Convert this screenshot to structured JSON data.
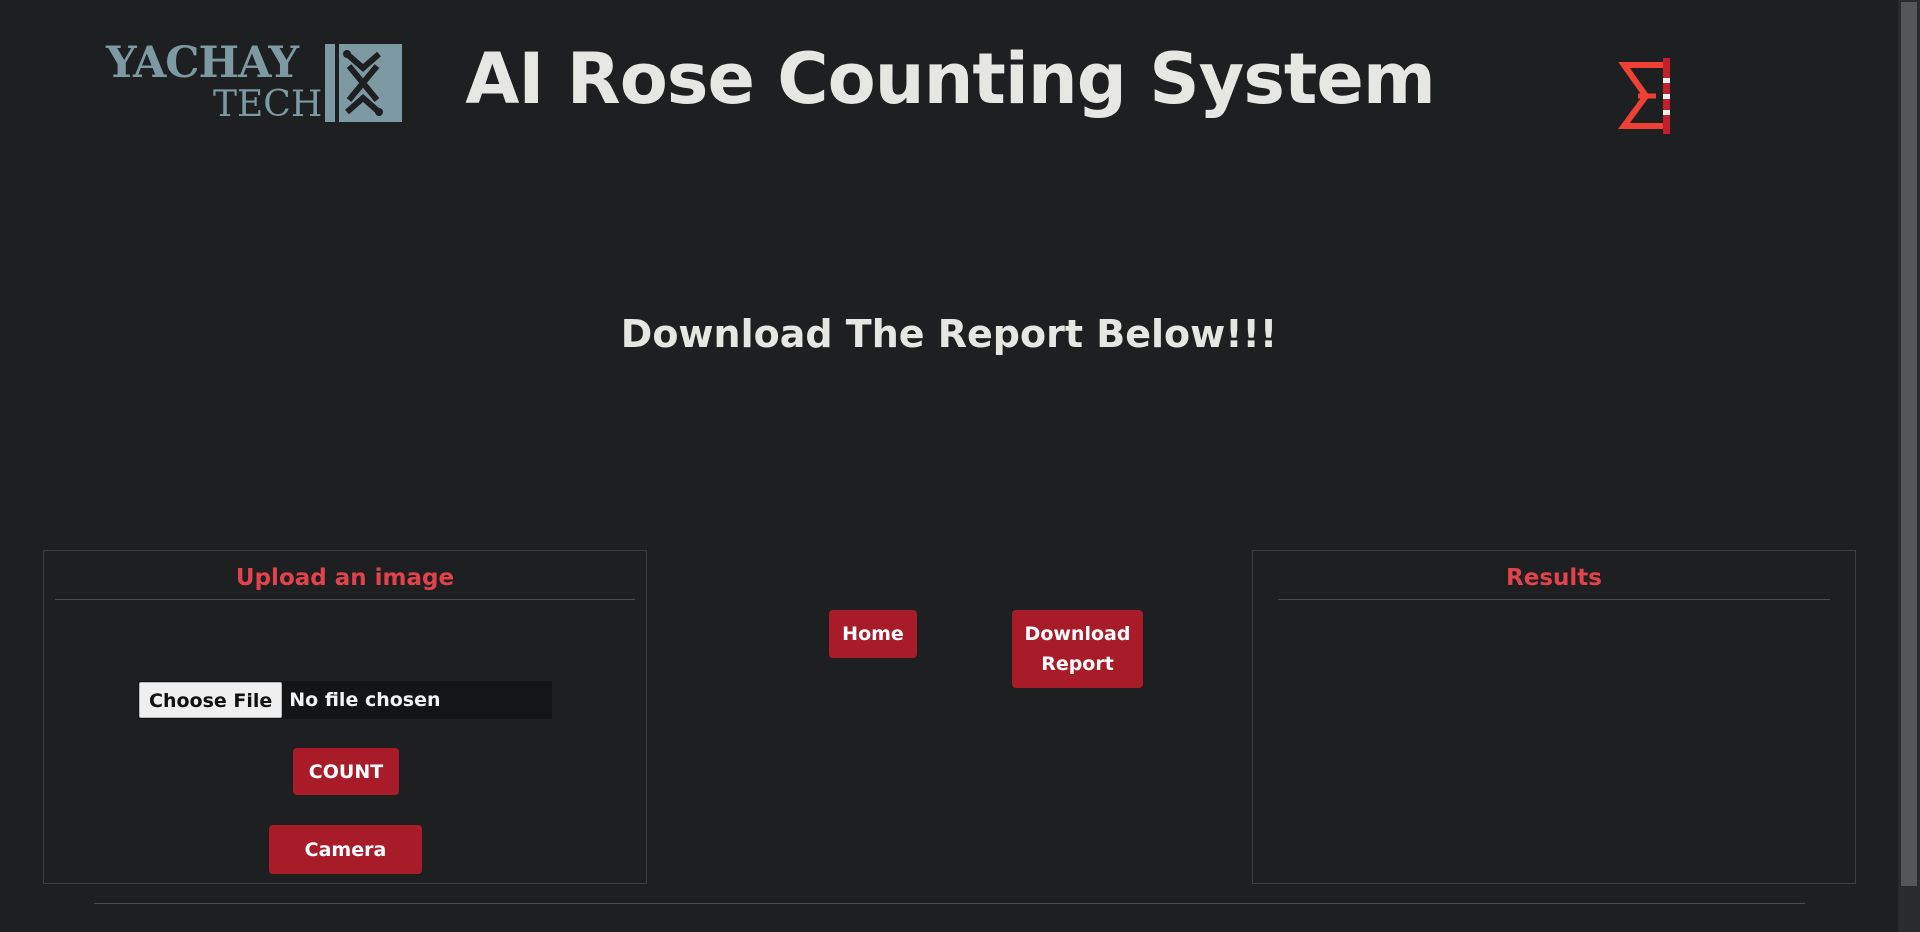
{
  "header": {
    "logo_line1": "YACHAY",
    "logo_line2": "TECH",
    "title": "AI Rose Counting System",
    "brand_color": "#7d9aa3",
    "accent_color": "#ee4035"
  },
  "subtitle": "Download The Report Below!!!",
  "upload_panel": {
    "title": "Upload an image",
    "choose_file_label": "Choose File",
    "file_status": "No file chosen",
    "count_label": "COUNT",
    "camera_label": "Camera"
  },
  "nav": {
    "home_label": "Home",
    "download_line1": "Download",
    "download_line2": "Report"
  },
  "results_panel": {
    "title": "Results"
  },
  "colors": {
    "background": "#1e1f21",
    "button": "#a81c2a",
    "panel_title": "#e0434c"
  }
}
